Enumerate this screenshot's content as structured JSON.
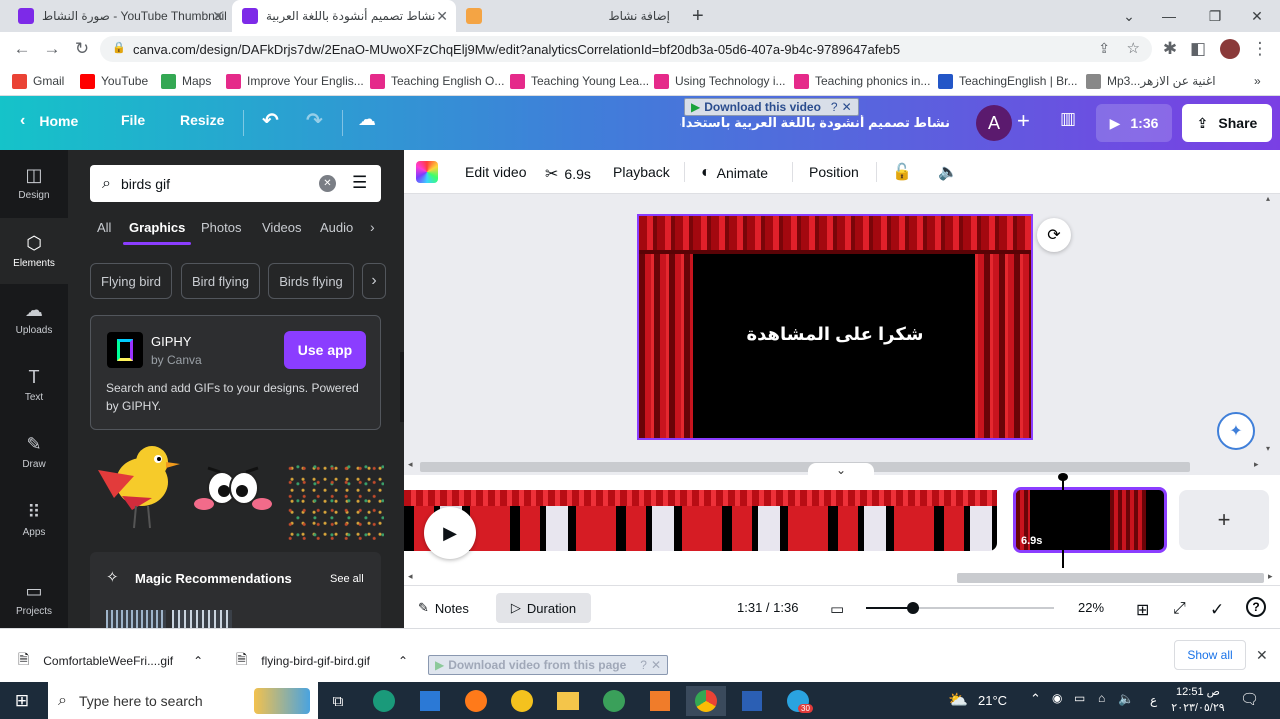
{
  "browser": {
    "tabs": [
      {
        "label": "صورة النشاط - YouTube Thumbnail",
        "active": false
      },
      {
        "label": "نشاط تصميم أنشودة باللغة العربية",
        "active": true
      },
      {
        "label": "",
        "active": false
      },
      {
        "label": "إضافة نشاط",
        "active": false
      }
    ],
    "url": "canva.com/design/DAFkDrjs7dw/2EnaO-MUwoXFzChqElj9Mw/edit?analyticsCorrelationId=bf20db3a-05d6-407a-9b4c-9789647afeb5",
    "bookmarks": [
      {
        "label": "Gmail",
        "color": "#ea4335"
      },
      {
        "label": "YouTube",
        "color": "#ff0000"
      },
      {
        "label": "Maps",
        "color": "#34a853"
      },
      {
        "label": "Improve Your Englis...",
        "color": "#e52a8a"
      },
      {
        "label": "Teaching English O...",
        "color": "#e52a8a"
      },
      {
        "label": "Teaching Young Lea...",
        "color": "#e52a8a"
      },
      {
        "label": "Using Technology i...",
        "color": "#e52a8a"
      },
      {
        "label": "Teaching phonics in...",
        "color": "#e52a8a"
      },
      {
        "label": "TeachingEnglish | Br...",
        "color": "#2356c7"
      },
      {
        "label": "Mp3...اغنية عن الازهر",
        "color": "#888888"
      }
    ],
    "more_bookmarks": "»"
  },
  "canva_topbar": {
    "home": "Home",
    "file": "File",
    "resize": "Resize",
    "design_title": "نشاط تصميم أنشودة باللغة العربية باستخدام كانفا",
    "download_overlay": "Download this video",
    "avatar_letter": "A",
    "play_time": "1:36",
    "share": "Share"
  },
  "rail": [
    {
      "label": "Design",
      "icon": "layout-icon"
    },
    {
      "label": "Elements",
      "icon": "shapes-icon",
      "active": true
    },
    {
      "label": "Uploads",
      "icon": "cloud-upload-icon"
    },
    {
      "label": "Text",
      "icon": "text-icon"
    },
    {
      "label": "Draw",
      "icon": "draw-icon"
    },
    {
      "label": "Apps",
      "icon": "apps-grid-icon"
    },
    {
      "label": "Projects",
      "icon": "folder-icon"
    }
  ],
  "panel": {
    "search_value": "birds gif",
    "tabs": [
      "All",
      "Graphics",
      "Photos",
      "Videos",
      "Audio"
    ],
    "chips": [
      "Flying bird",
      "Bird flying",
      "Birds flying"
    ],
    "giphy": {
      "name": "GIPHY",
      "by": "by Canva",
      "button": "Use app",
      "description": "Search and add GIFs to your designs. Powered by GIPHY."
    },
    "magic": {
      "title": "Magic Recommendations",
      "see_all": "See all"
    }
  },
  "context_bar": {
    "edit_video": "Edit video",
    "duration": "6.9s",
    "playback": "Playback",
    "animate": "Animate",
    "position": "Position"
  },
  "canvas": {
    "slide_text": "شكرا على المشاهدة"
  },
  "timeline": {
    "clip_duration": "6.9s"
  },
  "footer": {
    "notes": "Notes",
    "duration": "Duration",
    "time": "1:31 / 1:36",
    "zoom": "22%",
    "zoom_fraction": 0.25
  },
  "downloads": {
    "items": [
      "ComfortableWeeFri....gif",
      "flying-bird-gif-bird.gif"
    ],
    "overlay": "Download video from this page",
    "show_all": "Show all"
  },
  "taskbar": {
    "search_placeholder": "Type here to search",
    "temperature": "21°C",
    "time": "12:51",
    "ampm": "ص",
    "date": "٢٠٢٣/٠٥/٢٩",
    "lang": "ع",
    "notify_count": "30"
  }
}
